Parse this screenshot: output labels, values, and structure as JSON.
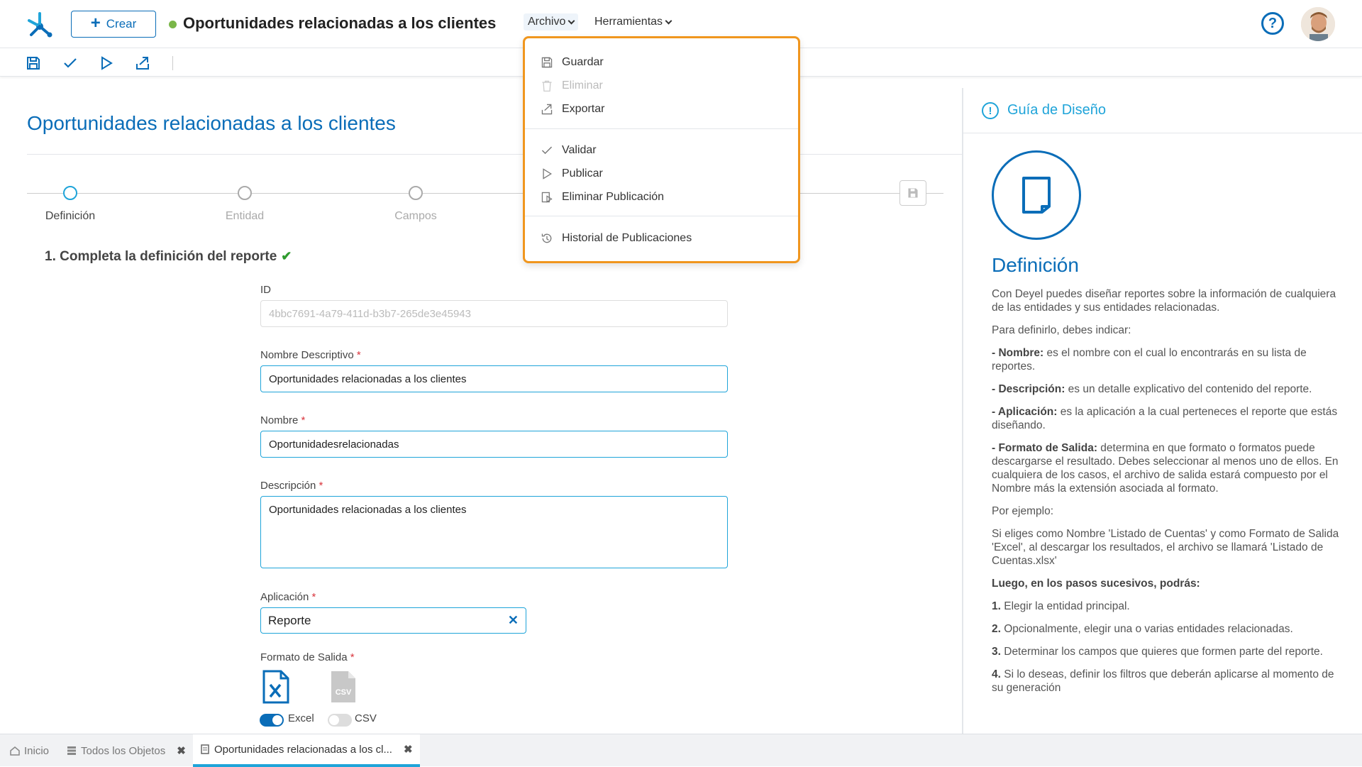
{
  "app": {
    "create_label": "Crear",
    "object_title": "Oportunidades relacionadas a los clientes",
    "menu_archivo": "Archivo",
    "menu_herramientas": "Herramientas",
    "help_label": "?"
  },
  "archivo_menu": {
    "guardar": "Guardar",
    "eliminar": "Eliminar",
    "exportar": "Exportar",
    "validar": "Validar",
    "publicar": "Publicar",
    "eliminar_publicacion": "Eliminar Publicación",
    "historial": "Historial de Publicaciones"
  },
  "page": {
    "title": "Oportunidades relacionadas a los clientes",
    "steps": [
      "Definición",
      "Entidad",
      "Campos"
    ],
    "section_title": "1. Completa la definición del reporte"
  },
  "form": {
    "id_label": "ID",
    "id_value": "4bbc7691-4a79-411d-b3b7-265de3e45943",
    "nombre_desc_label": "Nombre Descriptivo",
    "nombre_desc_value": "Oportunidades relacionadas a los clientes",
    "nombre_label": "Nombre",
    "nombre_value": "Oportunidadesrelacionadas",
    "descripcion_label": "Descripción",
    "descripcion_value": "Oportunidades relacionadas a los clientes",
    "aplicacion_label": "Aplicación",
    "aplicacion_value": "Reporte",
    "formato_label": "Formato de Salida",
    "excel_label": "Excel",
    "csv_label": "CSV",
    "required_mark": "*"
  },
  "guide": {
    "header": "Guía de Diseño",
    "title": "Definición",
    "p1": "Con Deyel puedes diseñar reportes sobre la información de cualquiera de las entidades y sus entidades relacionadas.",
    "p2": "Para definirlo, debes indicar:",
    "nombre_b": "- Nombre:",
    "nombre_t": " es el nombre con el cual lo encontrarás en su lista de reportes.",
    "desc_b": "- Descripción:",
    "desc_t": " es un detalle explicativo del contenido del reporte.",
    "app_b": "- Aplicación:",
    "app_t": " es la aplicación a la cual perteneces el reporte que estás diseñando.",
    "fmt_b": "- Formato de Salida:",
    "fmt_t": " determina en que formato o formatos puede descargarse el resultado. Debes seleccionar al menos uno de ellos. En cualquiera de los casos, el archivo de salida estará compuesto por el Nombre más la extensión asociada al formato.",
    "p3": "Por ejemplo:",
    "p4": "Si eliges como Nombre 'Listado de Cuentas' y como Formato de Salida 'Excel', al descargar los resultados, el archivo se llamará 'Listado de Cuentas.xlsx'",
    "p5": "Luego, en los pasos sucesivos, podrás:",
    "s1n": "1.",
    "s1": " Elegir la entidad principal.",
    "s2n": "2.",
    "s2": " Opcionalmente, elegir una o varias entidades relacionadas.",
    "s3n": "3.",
    "s3": " Determinar los campos que quieres que formen parte del reporte.",
    "s4n": "4.",
    "s4": " Si lo deseas, definir los filtros que deberán aplicarse al momento de su generación"
  },
  "bottom_tabs": {
    "inicio": "Inicio",
    "todos": "Todos los Objetos",
    "current": "Oportunidades relacionadas a los cl..."
  },
  "colors": {
    "primary": "#0a6db8",
    "accent": "#1fa4d9",
    "highlight": "#f0961e",
    "status": "#7ab648"
  }
}
